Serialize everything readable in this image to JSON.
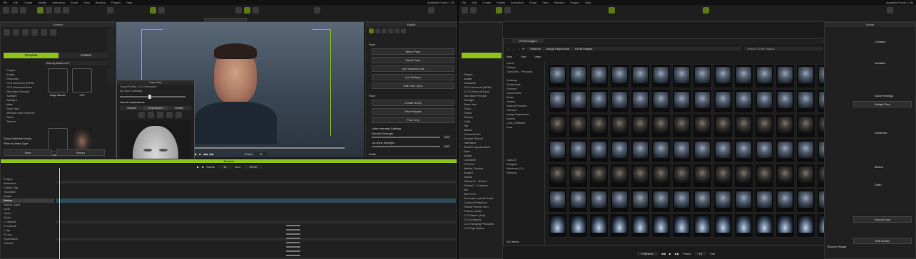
{
  "left": {
    "menu": [
      "File",
      "Edit",
      "Create",
      "Modify",
      "Animation",
      "Script",
      "View",
      "Window",
      "Plugins",
      "Help"
    ],
    "status": "Available Points: 1.5k",
    "content_panel": {
      "title": "Content",
      "tabs": [
        "Template",
        "Custom"
      ],
      "sort_label": "Sort by Name A-Z",
      "tree": [
        "Project",
        "Avatar",
        "Character",
        "CC4 Universal (NEW)",
        "CC3 Universal Base",
        "Neo Base Female",
        "Sunlight",
        "Starlight",
        "Male",
        "Shoe Hair",
        "Medium Hair Eyebrow",
        "Gloss",
        "Texture"
      ],
      "thumbs": [
        "Image Blender",
        "CC3"
      ],
      "thumb2": [
        "Reader, Others",
        "CC4 Connector"
      ],
      "checks": [
        "Show Subfolder Items",
        "Filter by Mask Type"
      ],
      "buttons": [
        "Save",
        "Return"
      ]
    },
    "face_key": {
      "title": "Face Key",
      "model_label": "Facial Profile: CC4 Extended",
      "morph_label": "Lip Sync Intensity",
      "tabs": [
        "Muscle",
        "Expression",
        "Modify"
      ],
      "checkbox": "Use all expressions",
      "strength_label": "Strength",
      "strength_value": "100",
      "buttons": [
        "Transfer Data",
        "Reset"
      ]
    },
    "viewport": {
      "frame_label": "Frame",
      "frame_value": "10"
    },
    "modify": {
      "title": "Modify",
      "section_pose": "Pose",
      "buttons": [
        "Mirror Pose",
        "Reset Pose",
        "Live Camera Link",
        "Live ReSync",
        "Edit Face Sync"
      ],
      "section_face": "Face",
      "buttons2": [
        "Create Script",
        "Face Puppet",
        "Face Key"
      ],
      "face_params": [
        "Voice Intensity Settings",
        "Smooth Strength",
        "Lip-Sync Strength"
      ],
      "val1": "100",
      "val2": "100",
      "section_smile": "Smile"
    },
    "timeline": {
      "title": "Timeline",
      "frame_label": "Frame",
      "frame_value": "10",
      "end_label": "End:",
      "end_value": "25.28",
      "tracks": [
        "Project",
        "Animation",
        "Collect Clip",
        "Transition",
        "Avatar",
        "Motion",
        "Motion Layer",
        "Neck",
        "Head",
        "Spine",
        "L Clavicle",
        "R Clavicle",
        "L Hip",
        "R Leg",
        "Expression",
        "Viseme"
      ]
    }
  },
  "right": {
    "menu": [
      "File",
      "Edit",
      "Create",
      "Modify",
      "Animation",
      "Script",
      "View",
      "Window",
      "Plugins",
      "Help"
    ],
    "status": "Available Points: 1.5k",
    "explorer": {
      "title": "IOVM Images",
      "breadcrumb": [
        "Pictures",
        "Image Sequences",
        "IOVM Images"
      ],
      "search_placeholder": "Search IOVM Images",
      "toolbar": [
        "New",
        "Sort",
        "View"
      ],
      "details": "Details",
      "nav": [
        "Home",
        "Gallery",
        "OneDrive - Personal",
        "Desktop",
        "Downloads",
        "Pictures",
        "Documents",
        "Music",
        "Videos",
        "Shared Pictures",
        "Network",
        "Image Sequences",
        "Assets",
        "Look_Wiffiwall",
        "Iona",
        "CapCut",
        "Seagate",
        "Windows (C:)",
        "Network"
      ],
      "footer": "140 items",
      "thumb_prefix": "track_",
      "thumb_suffix": ".png"
    },
    "left_tree": [
      "Project",
      "Avatar",
      "Character",
      "CC4 Universal (NEW)",
      "CC3 Universal Base",
      "Neo Base Female",
      "Sunlight",
      "Shoe Hair",
      "Gloss",
      "Frame",
      "Texture",
      "Cloth",
      "Hat",
      "Motion",
      "CharacterSet",
      "Female Blonde",
      "Hair/Base",
      "Sixtieth Upload Mark",
      "Eyes",
      "Avatar",
      "Character",
      "CC4 Ext",
      "Motion Contour",
      "Avatar1",
      "Stacks",
      "Glasses1 - Oxford",
      "Stacks2 - Combine",
      "Idle",
      "Mid Form",
      "Generate Upload Smile",
      "Custom Peekaboo",
      "Pocket Peeker Gen",
      "Pubicly Goblin",
      "CC3 Base+ (Ext)",
      "CC3 Anatomy",
      "CC4 Hanging Pendants",
      "CC4 Ego Bases"
    ],
    "right_panel": {
      "title": "Scene",
      "labels": [
        "Collapse",
        "Variation",
        "Guide Settings",
        "Weight Plan",
        "Dynamics",
        "Motion",
        "Drain",
        "Normal Dust",
        "Edit Details",
        "Bounce Range"
      ]
    },
    "bottom": {
      "fullframe": "Fullframe",
      "frame_value": "Frame",
      "num": "10",
      "end": "End"
    }
  },
  "colors": {
    "accent": "#8cc21a",
    "panel": "#202020",
    "bg": "#141414"
  }
}
